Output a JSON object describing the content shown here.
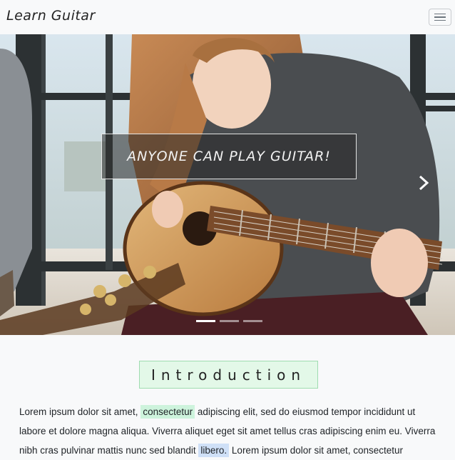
{
  "navbar": {
    "brand": "Learn Guitar",
    "toggle_icon": "hamburger-menu-icon"
  },
  "carousel": {
    "caption": "ANYONE CAN PLAY GUITAR!",
    "next_icon": "chevron-right-icon",
    "indicator_count": 3,
    "active_indicator": 1
  },
  "intro": {
    "heading": "Introduction",
    "text_1": "Lorem ipsum dolor sit amet, ",
    "highlight_1": "consectetur",
    "text_2": " adipiscing elit, sed do eiusmod tempor incididunt ut labore et dolore magna aliqua. Viverra aliquet eget sit amet tellus cras adipiscing enim eu. Viverra nibh cras pulvinar mattis nunc sed blandit ",
    "highlight_2": "libero.",
    "text_3": " Lorem ipsum dolor sit amet, consectetur"
  },
  "colors": {
    "highlight_green": "#cdf3dc",
    "highlight_blue": "#cfe0f7",
    "heading_bg": "#e3f8e8"
  }
}
